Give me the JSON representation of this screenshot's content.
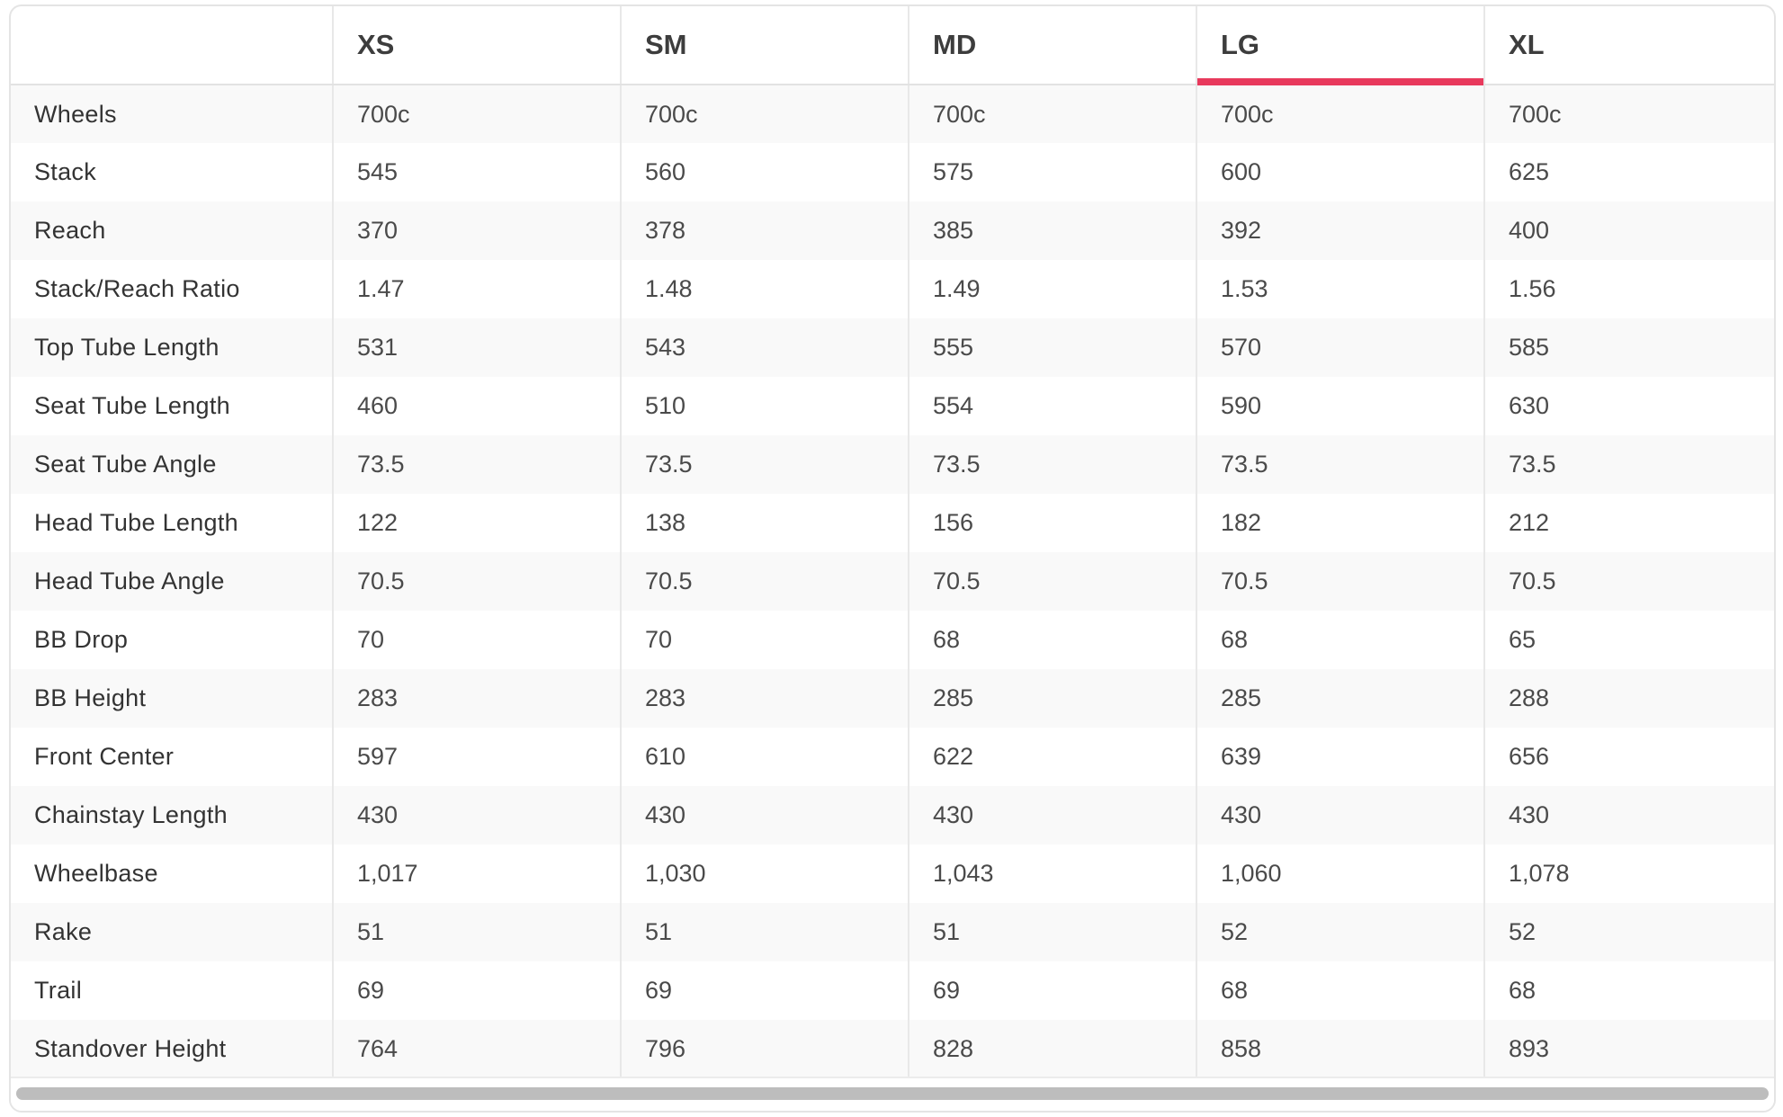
{
  "table": {
    "corner": "",
    "columns": [
      "XS",
      "SM",
      "MD",
      "LG",
      "XL"
    ],
    "selected_column": "LG",
    "accent_color": "#e8395c",
    "rows": [
      {
        "label": "Wheels",
        "values": [
          "700c",
          "700c",
          "700c",
          "700c",
          "700c"
        ]
      },
      {
        "label": "Stack",
        "values": [
          "545",
          "560",
          "575",
          "600",
          "625"
        ]
      },
      {
        "label": "Reach",
        "values": [
          "370",
          "378",
          "385",
          "392",
          "400"
        ]
      },
      {
        "label": "Stack/Reach Ratio",
        "values": [
          "1.47",
          "1.48",
          "1.49",
          "1.53",
          "1.56"
        ]
      },
      {
        "label": "Top Tube Length",
        "values": [
          "531",
          "543",
          "555",
          "570",
          "585"
        ]
      },
      {
        "label": "Seat Tube Length",
        "values": [
          "460",
          "510",
          "554",
          "590",
          "630"
        ]
      },
      {
        "label": "Seat Tube Angle",
        "values": [
          "73.5",
          "73.5",
          "73.5",
          "73.5",
          "73.5"
        ]
      },
      {
        "label": "Head Tube Length",
        "values": [
          "122",
          "138",
          "156",
          "182",
          "212"
        ]
      },
      {
        "label": "Head Tube Angle",
        "values": [
          "70.5",
          "70.5",
          "70.5",
          "70.5",
          "70.5"
        ]
      },
      {
        "label": "BB Drop",
        "values": [
          "70",
          "70",
          "68",
          "68",
          "65"
        ]
      },
      {
        "label": "BB Height",
        "values": [
          "283",
          "283",
          "285",
          "285",
          "288"
        ]
      },
      {
        "label": "Front Center",
        "values": [
          "597",
          "610",
          "622",
          "639",
          "656"
        ]
      },
      {
        "label": "Chainstay Length",
        "values": [
          "430",
          "430",
          "430",
          "430",
          "430"
        ]
      },
      {
        "label": "Wheelbase",
        "values": [
          "1,017",
          "1,030",
          "1,043",
          "1,060",
          "1,078"
        ]
      },
      {
        "label": "Rake",
        "values": [
          "51",
          "51",
          "51",
          "52",
          "52"
        ]
      },
      {
        "label": "Trail",
        "values": [
          "69",
          "69",
          "69",
          "68",
          "68"
        ]
      },
      {
        "label": "Standover Height",
        "values": [
          "764",
          "796",
          "828",
          "858",
          "893"
        ]
      }
    ]
  }
}
